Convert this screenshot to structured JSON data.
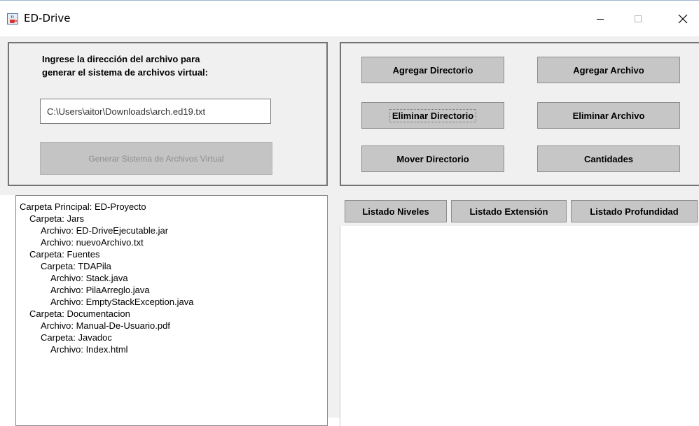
{
  "window": {
    "title": "ED-Drive",
    "app_icon": "java-cup-icon",
    "minimize_icon": "minimize-icon",
    "maximize_icon": "maximize-icon",
    "close_icon": "close-icon"
  },
  "input_panel": {
    "instruction_line1": "Ingrese la dirección del archivo para",
    "instruction_line2": "generar el sistema de archivos virtual:",
    "path_value": "C:\\Users\\aitor\\Downloads\\arch.ed19.txt",
    "generate_label": "Generar Sistema de Archivos Virtual"
  },
  "actions": {
    "add_directory": "Agregar Directorio",
    "add_file": "Agregar Archivo",
    "delete_directory": "Eliminar Directorio",
    "delete_file": "Eliminar Archivo",
    "move_directory": "Mover Directorio",
    "counts": "Cantidades"
  },
  "tree": {
    "lines": [
      "Carpeta Principal: ED-Proyecto",
      "Carpeta: Jars",
      "Archivo: ED-DriveEjecutable.jar",
      "Archivo: nuevoArchivo.txt",
      "Carpeta: Fuentes",
      "Carpeta: TDAPila",
      "Archivo: Stack.java",
      "Archivo: PilaArreglo.java",
      "Archivo: EmptyStackException.java",
      "Carpeta: Documentacion",
      "Archivo: Manual-De-Usuario.pdf",
      "Carpeta: Javadoc",
      "Archivo: Index.html"
    ]
  },
  "listing": {
    "levels_label": "Listado Niveles",
    "extension_label": "Listado Extensión",
    "depth_label": "Listado Profundidad"
  },
  "colors": {
    "panel_border": "#737373",
    "button_bg": "#c6c6c6",
    "window_bg": "#f0f0f0"
  }
}
